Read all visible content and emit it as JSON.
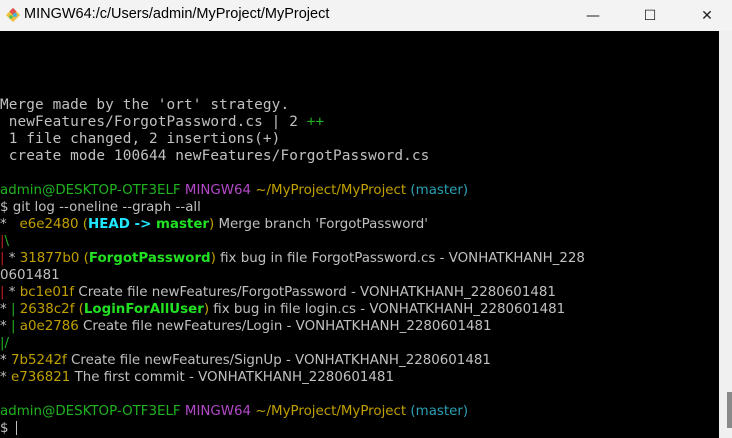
{
  "window": {
    "title": "MINGW64:/c/Users/admin/MyProject/MyProject",
    "icon": "git-bash-icon",
    "minimize_label": "—",
    "maximize_label": "☐",
    "close_label": "✕"
  },
  "colors": {
    "text": "#c0c0c0",
    "hash": "#c0a000",
    "user": "#1fb41f",
    "mingw": "#b248c8",
    "path": "#c0a000",
    "branch": "#2aa1b3",
    "head": "#1ee8ff",
    "local_branch": "#22e022",
    "graph_red": "#c02020",
    "graph_green": "#22b022",
    "plus": "#22b022"
  },
  "terminal": {
    "lines": [
      {
        "mono": true,
        "segs": [
          {
            "t": "Merge made by the 'ort' strategy.",
            "c": "text"
          }
        ]
      },
      {
        "mono": true,
        "segs": [
          {
            "t": " newFeatures/ForgotPassword.cs | 2 ",
            "c": "text"
          },
          {
            "t": "++",
            "c": "plus"
          }
        ]
      },
      {
        "mono": true,
        "segs": [
          {
            "t": " 1 file changed, 2 insertions(+)",
            "c": "text"
          }
        ]
      },
      {
        "mono": true,
        "segs": [
          {
            "t": " create mode 100644 newFeatures/ForgotPassword.cs",
            "c": "text"
          }
        ]
      },
      {
        "segs": []
      },
      {
        "segs": [
          {
            "t": "admin@DESKTOP-OTF3ELF ",
            "c": "user"
          },
          {
            "t": "MINGW64 ",
            "c": "mingw"
          },
          {
            "t": "~/MyProject/MyProject ",
            "c": "path"
          },
          {
            "t": "(master)",
            "c": "branch"
          }
        ]
      },
      {
        "segs": [
          {
            "t": "$ git log --oneline --graph --all",
            "c": "text"
          }
        ]
      },
      {
        "segs": [
          {
            "t": "*   ",
            "c": "text"
          },
          {
            "t": "e6e2480 (",
            "c": "hash"
          },
          {
            "t": "HEAD -> ",
            "c": "head",
            "b": true
          },
          {
            "t": "master",
            "c": "local_branch",
            "b": true
          },
          {
            "t": ") ",
            "c": "hash"
          },
          {
            "t": "Merge branch 'ForgotPassword'",
            "c": "text"
          }
        ]
      },
      {
        "segs": [
          {
            "t": "|",
            "c": "graph_red"
          },
          {
            "t": "\\",
            "c": "graph_green"
          }
        ]
      },
      {
        "segs": [
          {
            "t": "|",
            "c": "graph_red"
          },
          {
            "t": " * ",
            "c": "text"
          },
          {
            "t": "31877b0 (",
            "c": "hash"
          },
          {
            "t": "ForgotPassword",
            "c": "local_branch",
            "b": true
          },
          {
            "t": ") ",
            "c": "hash"
          },
          {
            "t": "fix bug in file ForgotPassword.cs - VONHATKHANH_228",
            "c": "text"
          }
        ]
      },
      {
        "segs": [
          {
            "t": "0601481",
            "c": "text"
          }
        ]
      },
      {
        "segs": [
          {
            "t": "|",
            "c": "graph_red"
          },
          {
            "t": " * ",
            "c": "text"
          },
          {
            "t": "bc1e01f ",
            "c": "hash"
          },
          {
            "t": "Create file newFeatures/ForgotPassword - VONHATKHANH_2280601481",
            "c": "text"
          }
        ]
      },
      {
        "segs": [
          {
            "t": "* ",
            "c": "text"
          },
          {
            "t": "| ",
            "c": "graph_green"
          },
          {
            "t": "2638c2f (",
            "c": "hash"
          },
          {
            "t": "LoginForAllUser",
            "c": "local_branch",
            "b": true
          },
          {
            "t": ") ",
            "c": "hash"
          },
          {
            "t": "fix bug in file login.cs - VONHATKHANH_2280601481",
            "c": "text"
          }
        ]
      },
      {
        "segs": [
          {
            "t": "* ",
            "c": "text"
          },
          {
            "t": "| ",
            "c": "graph_green"
          },
          {
            "t": "a0e2786 ",
            "c": "hash"
          },
          {
            "t": "Create file newFeatures/Login - VONHATKHANH_2280601481",
            "c": "text"
          }
        ]
      },
      {
        "segs": [
          {
            "t": "|/",
            "c": "graph_green"
          }
        ]
      },
      {
        "segs": [
          {
            "t": "* ",
            "c": "text"
          },
          {
            "t": "7b5242f ",
            "c": "hash"
          },
          {
            "t": "Create file newFeatures/SignUp - VONHATKHANH_2280601481",
            "c": "text"
          }
        ]
      },
      {
        "segs": [
          {
            "t": "* ",
            "c": "text"
          },
          {
            "t": "e736821 ",
            "c": "hash"
          },
          {
            "t": "The first commit - VONHATKHANH_2280601481",
            "c": "text"
          }
        ]
      },
      {
        "segs": []
      },
      {
        "segs": [
          {
            "t": "admin@DESKTOP-OTF3ELF ",
            "c": "user"
          },
          {
            "t": "MINGW64 ",
            "c": "mingw"
          },
          {
            "t": "~/MyProject/MyProject ",
            "c": "path"
          },
          {
            "t": "(master)",
            "c": "branch"
          }
        ]
      },
      {
        "segs": [
          {
            "t": "$ ",
            "c": "text"
          }
        ],
        "cursor": true
      }
    ]
  }
}
